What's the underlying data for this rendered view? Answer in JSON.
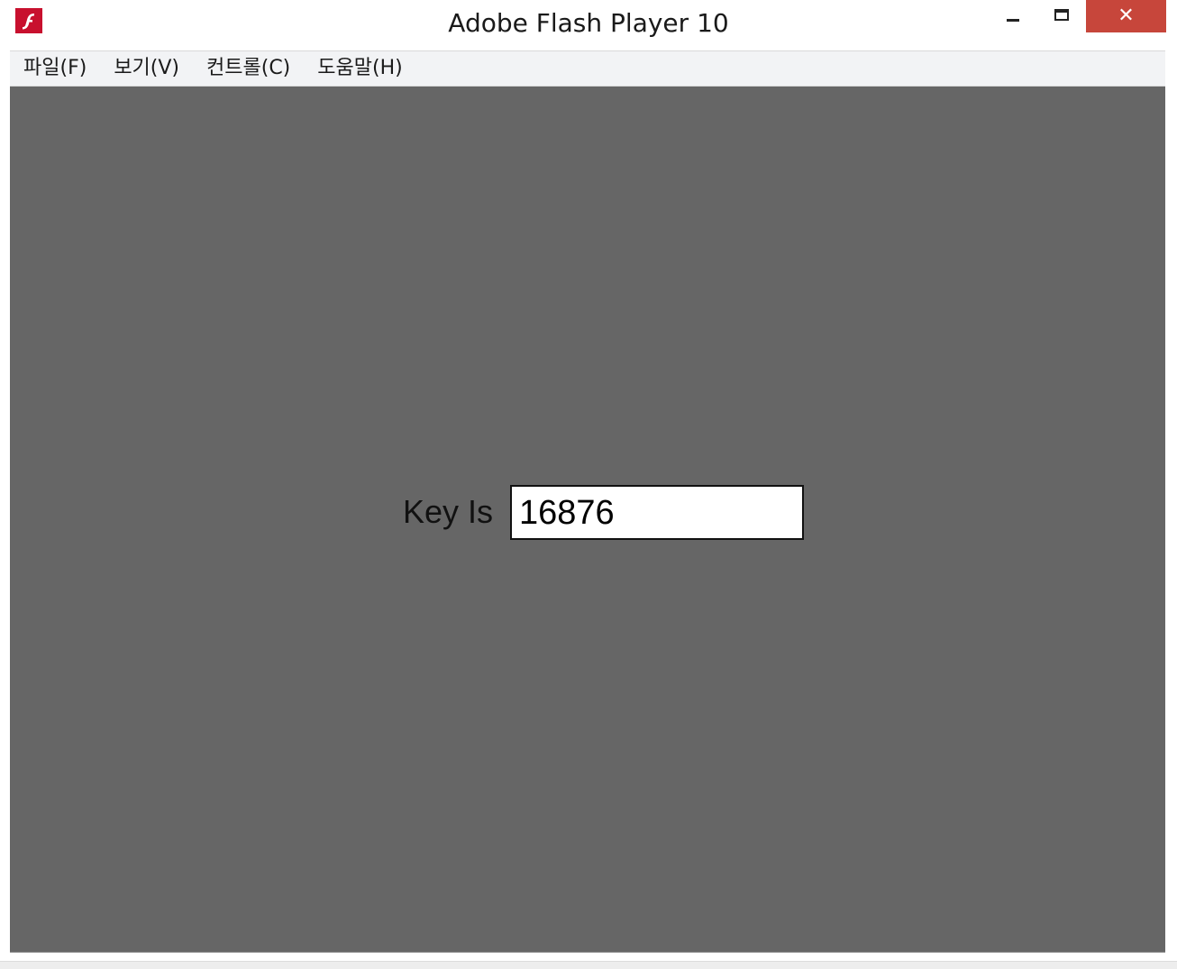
{
  "window": {
    "title": "Adobe Flash Player 10",
    "icon": "flash-player-icon",
    "controls": {
      "minimize": "minimize-icon",
      "maximize": "maximize-icon",
      "close_label": "✕"
    }
  },
  "menubar": {
    "items": [
      {
        "label": "파일(F)"
      },
      {
        "label": "보기(V)"
      },
      {
        "label": "컨트롤(C)"
      },
      {
        "label": "도움말(H)"
      }
    ]
  },
  "stage": {
    "background": "#666666",
    "key_label": "Key Is",
    "key_value": "16876"
  },
  "colors": {
    "close_button": "#c7463b",
    "icon_red": "#c8102e",
    "menubar_bg": "#f2f3f5"
  }
}
